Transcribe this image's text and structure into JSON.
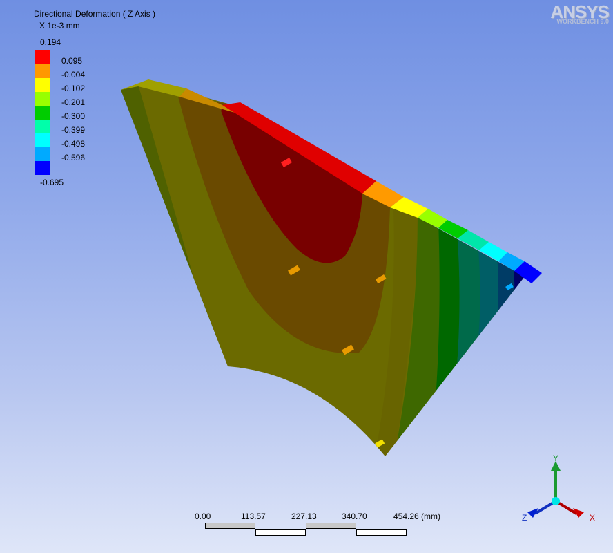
{
  "result": {
    "title": "Directional Deformation ( Z Axis )",
    "units": "X 1e-3 mm"
  },
  "legend": {
    "max": "0.194",
    "min": "-0.695",
    "labels": [
      "0.095",
      "-0.004",
      "-0.102",
      "-0.201",
      "-0.300",
      "-0.399",
      "-0.498",
      "-0.596"
    ],
    "colors": [
      "#ff0000",
      "#ff9900",
      "#ffff00",
      "#99ff00",
      "#00cc00",
      "#00ffaa",
      "#00ffff",
      "#00aaff",
      "#0000ff"
    ]
  },
  "logo": {
    "brand": "ANSYS",
    "product": "WORKBENCH 9.0"
  },
  "scale": {
    "ticks": [
      "0.00",
      "113.57",
      "227.13",
      "340.70",
      "454.26 (mm)"
    ]
  },
  "triad": {
    "y": "Y",
    "x": "X",
    "z": "Z"
  }
}
